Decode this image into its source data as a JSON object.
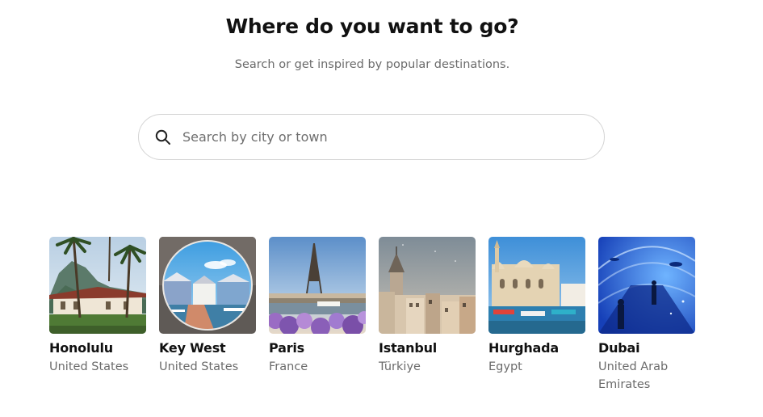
{
  "header": {
    "title": "Where do you want to go?",
    "subtitle": "Search or get inspired by popular destinations."
  },
  "search": {
    "placeholder": "Search by city or town",
    "icon": "search-icon"
  },
  "destinations": [
    {
      "city": "Honolulu",
      "country": "United States"
    },
    {
      "city": "Key West",
      "country": "United States"
    },
    {
      "city": "Paris",
      "country": "France"
    },
    {
      "city": "Istanbul",
      "country": "Türkiye"
    },
    {
      "city": "Hurghada",
      "country": "Egypt"
    },
    {
      "city": "Dubai",
      "country": "United Arab Emirates"
    }
  ]
}
